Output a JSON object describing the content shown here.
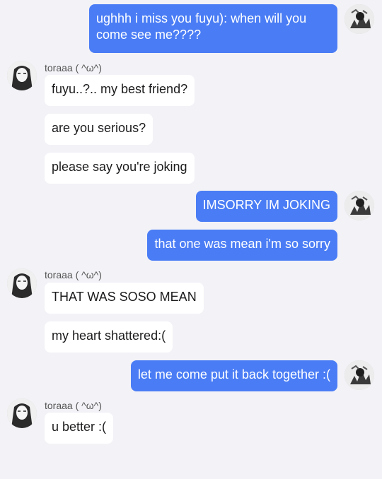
{
  "conversation": {
    "messages": [
      {
        "sender": "fuyu",
        "text": "ughhh i miss you fuyu): when will you come see me????"
      },
      {
        "sender": "toraaa",
        "name": "toraaa ( ^ω^)",
        "text": "fuyu..?.. my best friend?"
      },
      {
        "sender": "toraaa",
        "text": "are you serious?"
      },
      {
        "sender": "toraaa",
        "text": "please say you're joking"
      },
      {
        "sender": "fuyu",
        "text": "IMSORRY IM JOKING"
      },
      {
        "sender": "fuyu",
        "text": "that one was mean i'm so sorry"
      },
      {
        "sender": "toraaa",
        "name": "toraaa ( ^ω^)",
        "text": "THAT WAS SOSO MEAN"
      },
      {
        "sender": "toraaa",
        "text": "my heart shattered:("
      },
      {
        "sender": "fuyu",
        "text": "let me come put it back together :("
      },
      {
        "sender": "toraaa",
        "name": "toraaa ( ^ω^)",
        "text": "u better :("
      }
    ]
  },
  "colors": {
    "outgoing_bubble": "#4a7df5",
    "incoming_bubble": "#ffffff",
    "background": "#f2f2f7"
  }
}
